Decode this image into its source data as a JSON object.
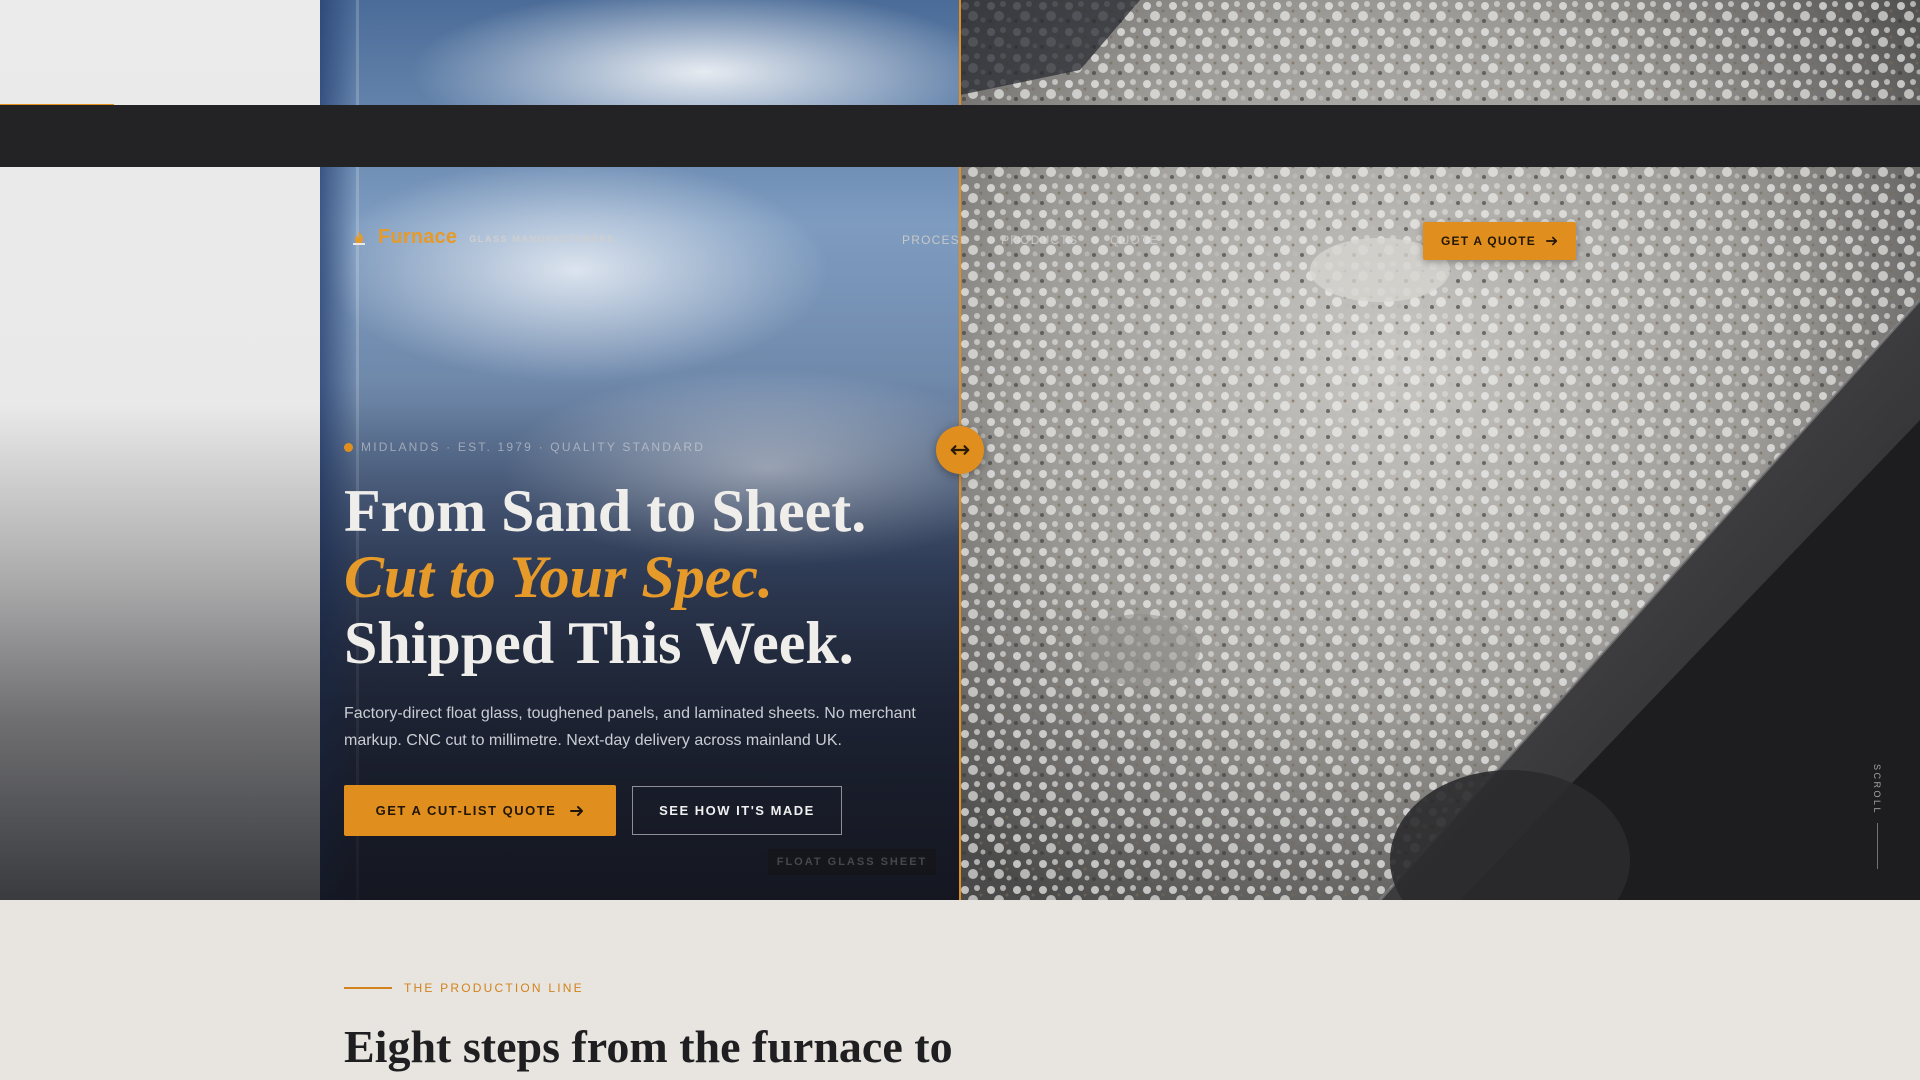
{
  "nav": {
    "brand": "Furnace",
    "brand_sub": "GLASS MANUFACTURERS",
    "links": [
      "PROCESS",
      "PRODUCTS",
      "QUOTE"
    ],
    "cta_label": "GET A QUOTE",
    "accent_color": "#e08f1e"
  },
  "hero": {
    "tagline": "MIDLANDS · EST. 1979 · QUALITY STANDARD",
    "headline_line1": "From Sand to Sheet.",
    "headline_line2": "Cut to Your Spec.",
    "headline_line3": "Shipped This Week.",
    "lede": "Factory-direct float glass, toughened panels, and laminated sheets. No merchant markup. CNC cut to millimetre. Next-day delivery across mainland UK.",
    "primary_cta": "GET A CUT-LIST QUOTE",
    "secondary_cta": "SEE HOW IT'S MADE",
    "image_caption": "FLOAT GLASS SHEET",
    "scroll_label": "SCROLL"
  },
  "section": {
    "eyebrow": "THE PRODUCTION LINE",
    "title": "Eight steps from the furnace to"
  }
}
